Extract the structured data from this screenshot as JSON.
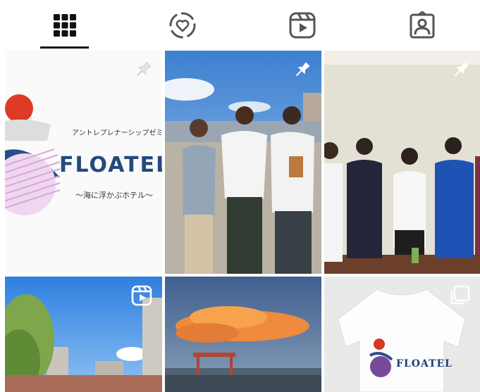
{
  "tabs": [
    {
      "name": "grid-icon",
      "active": true
    },
    {
      "name": "collab-icon",
      "active": false
    },
    {
      "name": "reels-icon",
      "active": false
    },
    {
      "name": "tagged-icon",
      "active": false
    }
  ],
  "posts": [
    {
      "id": "post-1",
      "subtitle": "アントレプレナーシップゼミ",
      "logo": "FLOATEL",
      "tagline": "〜海に浮かぶホテル〜",
      "pinned": true
    },
    {
      "id": "post-2",
      "pinned": true
    },
    {
      "id": "post-3",
      "pinned": true
    },
    {
      "id": "post-4",
      "reel": true
    },
    {
      "id": "post-5"
    },
    {
      "id": "post-6",
      "logo": "FLOATEL",
      "multi": true
    }
  ]
}
